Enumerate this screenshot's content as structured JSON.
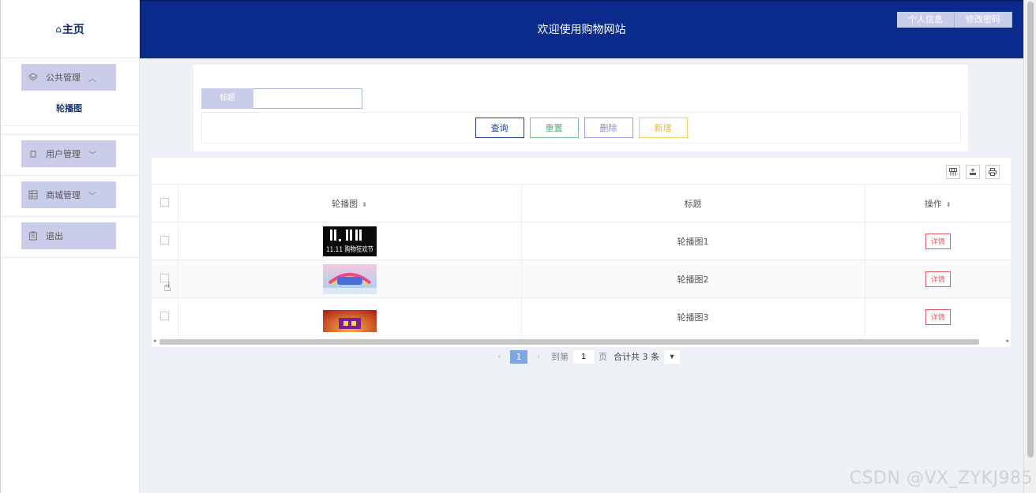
{
  "sidebar": {
    "logo": "主页",
    "menus": [
      {
        "label": "公共管理",
        "expanded": true,
        "children": [
          "轮播图"
        ]
      },
      {
        "label": "用户管理",
        "expanded": false
      },
      {
        "label": "商城管理",
        "expanded": false
      },
      {
        "label": "退出"
      }
    ]
  },
  "header": {
    "title": "欢迎使用购物网站",
    "buttons": [
      "个人信息",
      "修改密码"
    ]
  },
  "search": {
    "field_label": "标题",
    "field_value": "",
    "buttons": {
      "query": "查询",
      "reset": "重置",
      "delete": "删除",
      "add": "新增"
    }
  },
  "table": {
    "columns": [
      "轮播图",
      "标题",
      "操作"
    ],
    "rows": [
      {
        "image": "11.11 购物狂欢节",
        "title": "轮播图1",
        "action": "详情"
      },
      {
        "image": "banner-2",
        "title": "轮播图2",
        "action": "详情"
      },
      {
        "image": "banner-3",
        "title": "轮播图3",
        "action": "详情"
      }
    ]
  },
  "pager": {
    "current": "1",
    "goto_label": "到第",
    "page_input": "1",
    "page_suffix": "页",
    "total": "合计共 3 条"
  },
  "watermark": "CSDN @VX_ZYKJ985",
  "colors": {
    "header": "#0a2b8c",
    "menu": "#c9cde9",
    "accent_red": "#e35a5a"
  }
}
